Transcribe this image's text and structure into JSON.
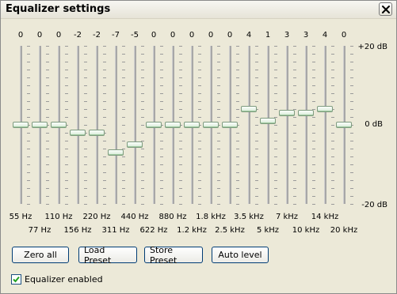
{
  "window": {
    "title": "Equalizer settings"
  },
  "eq": {
    "db_labels": [
      "+20 dB",
      "0 dB",
      "-20 dB"
    ],
    "db_range": [
      -20,
      20
    ],
    "bands": [
      {
        "value": 0,
        "label": "55 Hz"
      },
      {
        "value": 0,
        "label": "77 Hz"
      },
      {
        "value": 0,
        "label": "110 Hz"
      },
      {
        "value": -2,
        "label": "156 Hz"
      },
      {
        "value": -2,
        "label": "220 Hz"
      },
      {
        "value": -7,
        "label": "311 Hz"
      },
      {
        "value": -5,
        "label": "440 Hz"
      },
      {
        "value": 0,
        "label": "622 Hz"
      },
      {
        "value": 0,
        "label": "880 Hz"
      },
      {
        "value": 0,
        "label": "1.2 kHz"
      },
      {
        "value": 0,
        "label": "1.8 kHz"
      },
      {
        "value": 0,
        "label": "2.5 kHz"
      },
      {
        "value": 4,
        "label": "3.5 kHz"
      },
      {
        "value": 1,
        "label": "5 kHz"
      },
      {
        "value": 3,
        "label": "7 kHz"
      },
      {
        "value": 3,
        "label": "10 kHz"
      },
      {
        "value": 4,
        "label": "14 kHz"
      },
      {
        "value": 0,
        "label": "20 kHz"
      }
    ]
  },
  "buttons": {
    "zero_all": "Zero all",
    "load_preset": "Load Preset",
    "store_preset": "Store Preset",
    "auto_level": "Auto level"
  },
  "checkbox": {
    "label": "Equalizer enabled",
    "checked": true
  }
}
